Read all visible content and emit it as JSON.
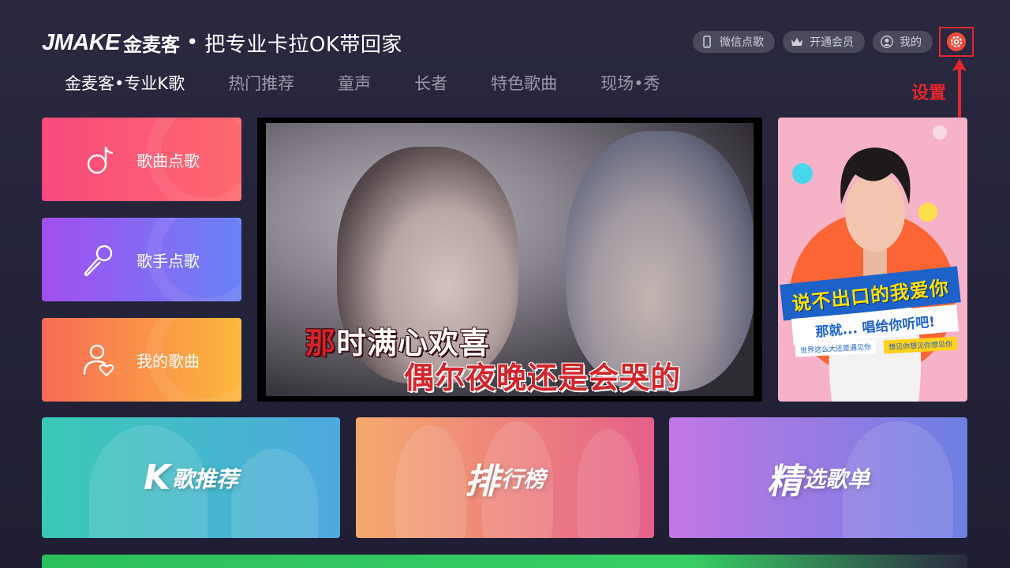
{
  "brand": {
    "logo": "JMAKE",
    "name_cn": "金麦客",
    "separator": "•",
    "slogan": "把专业卡拉OK带回家"
  },
  "top_actions": [
    {
      "label": "微信点歌",
      "icon": "phone-icon"
    },
    {
      "label": "开通会员",
      "icon": "crown-icon"
    },
    {
      "label": "我的",
      "icon": "user-icon"
    }
  ],
  "settings": {
    "icon": "gear-icon",
    "annotation_label": "设置",
    "annotation_color": "#e2262f"
  },
  "nav": {
    "tabs": [
      {
        "label": "金麦客•专业K歌",
        "active": true
      },
      {
        "label": "热门推荐"
      },
      {
        "label": "童声"
      },
      {
        "label": "长者"
      },
      {
        "label": "特色歌曲"
      },
      {
        "label": "现场•秀"
      }
    ]
  },
  "cards": [
    {
      "label": "歌曲点歌",
      "icon": "music-note-icon"
    },
    {
      "label": "歌手点歌",
      "icon": "microphone-icon"
    },
    {
      "label": "我的歌曲",
      "icon": "user-heart-icon"
    }
  ],
  "video": {
    "lyric_line1_sung": "那",
    "lyric_line1_rest": "时满心欢喜",
    "lyric_line2": "偶尔夜晚还是会哭的"
  },
  "poster": {
    "title": "说不出口的我爱你",
    "subtitle": "那就... 唱给你听吧!",
    "tag_a": "世界这么大还是遇见你",
    "tag_b": "想见你想见你想见你"
  },
  "features": [
    {
      "big": "K",
      "rest": "歌推荐"
    },
    {
      "big": "排",
      "rest": "行榜"
    },
    {
      "big": "精",
      "rest": "选歌单"
    }
  ],
  "colors": {
    "background": "#24233a",
    "accent_red": "#e2262f",
    "card1": "#f8497c",
    "card2": "#a24ff0",
    "card3": "#fbb83c"
  }
}
